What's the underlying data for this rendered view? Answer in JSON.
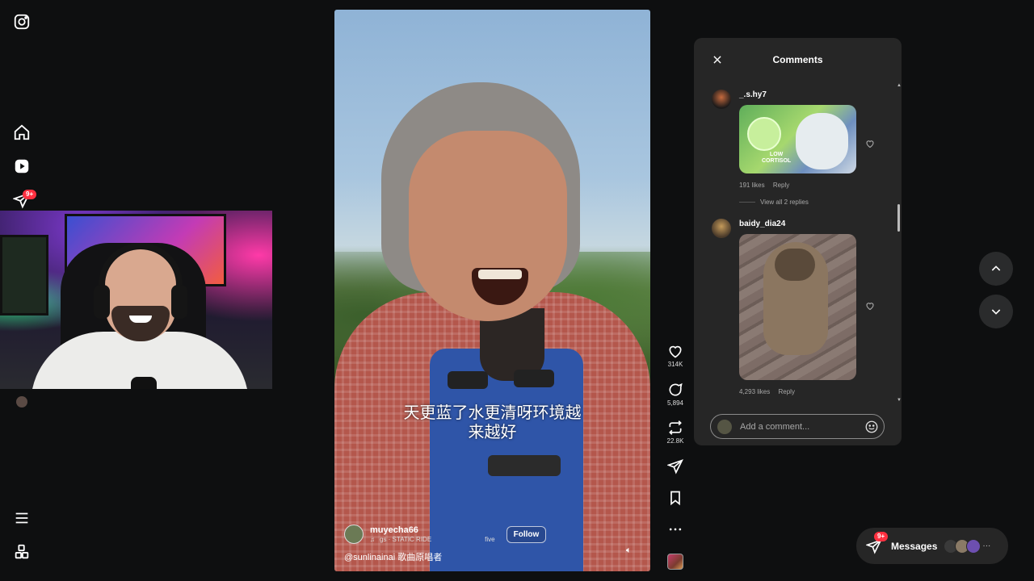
{
  "sidebar": {
    "items": [
      {
        "name": "instagram-icon"
      },
      {
        "name": "home-icon"
      },
      {
        "name": "reels-icon"
      },
      {
        "name": "messages-icon",
        "badge": "9+"
      },
      {
        "name": "more-menu-icon"
      },
      {
        "name": "also-from-meta-icon"
      }
    ]
  },
  "video": {
    "subtitle_line1": "天更蓝了水更清呀环境越",
    "subtitle_line2": "来越好",
    "author": "muyecha66",
    "audio_text": "gs · STATIC RIDE",
    "audio_text_right": "five",
    "follow_label": "Follow",
    "caption": "@sunlinainai 歌曲原唱者"
  },
  "actions": {
    "like_count": "314K",
    "comment_count": "5,894",
    "repost_count": "22.8K"
  },
  "comments": {
    "title": "Comments",
    "items": [
      {
        "user": "_.s.hy7",
        "likes": "191 likes",
        "reply": "Reply",
        "image_text": "LOW\nCORTISOL"
      },
      {
        "user": "baidy_dia24",
        "likes": "4,293 likes",
        "reply": "Reply"
      }
    ],
    "view_replies": "View all 2 replies",
    "input_placeholder": "Add a comment..."
  },
  "messages": {
    "label": "Messages",
    "badge": "9+",
    "more": "···"
  },
  "colors": {
    "background": "#0e0f10",
    "panel": "#262626",
    "badge": "#ff3040"
  }
}
